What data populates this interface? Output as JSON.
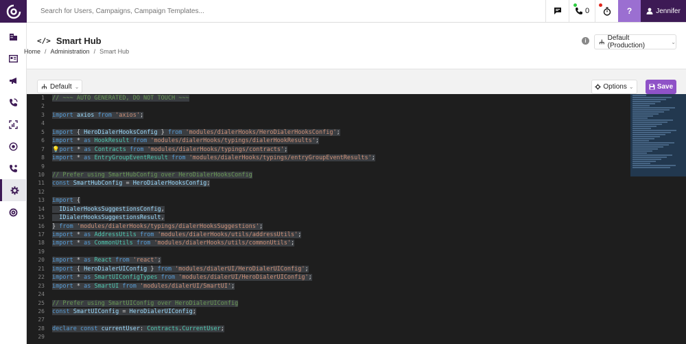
{
  "search": {
    "placeholder": "Search for Users, Campaigns, Campaign Templates..."
  },
  "topbar": {
    "calls_count": "0",
    "user_name": "Jennifer",
    "help_label": "?"
  },
  "header": {
    "title": "Smart Hub",
    "breadcrumb": [
      "Home",
      "Administration",
      "Smart Hub"
    ],
    "environment": "Default (Production)"
  },
  "toolbar": {
    "branch": "Default",
    "options_label": "Options",
    "save_label": "Save"
  },
  "colors": {
    "brand": "#3d1a55",
    "accent": "#8f52c7",
    "help": "#9b6fd1",
    "dot_green": "#2ecc40",
    "dot_red": "#e0261b"
  },
  "sidebar": {
    "items": [
      "building-icon",
      "id-card-icon",
      "megaphone-icon",
      "phone-icon",
      "dashboard-icon",
      "target-icon",
      "phone-settings-icon",
      "gear-icon",
      "logo-mark-icon"
    ],
    "active_index": 7
  },
  "editor": {
    "lines": [
      {
        "n": "1",
        "parts": [
          [
            "cm",
            "// ~~~ AUTO GENERATED, DO NOT TOUCH ~~~"
          ]
        ]
      },
      {
        "n": "2",
        "parts": []
      },
      {
        "n": "3",
        "parts": [
          [
            "kw",
            "import "
          ],
          [
            "id",
            "axios "
          ],
          [
            "kw",
            "from "
          ],
          [
            "str",
            "'axios'"
          ],
          [
            "op",
            ";"
          ]
        ]
      },
      {
        "n": "4",
        "parts": []
      },
      {
        "n": "5",
        "parts": [
          [
            "kw",
            "import "
          ],
          [
            "op",
            "{ "
          ],
          [
            "id",
            "HeroDialerHooksConfig "
          ],
          [
            "op",
            "} "
          ],
          [
            "kw",
            "from "
          ],
          [
            "str",
            "'modules/dialerHooks/HeroDialerHooksConfig'"
          ],
          [
            "op",
            ";"
          ]
        ]
      },
      {
        "n": "6",
        "parts": [
          [
            "kw",
            "import "
          ],
          [
            "op",
            "* "
          ],
          [
            "kw",
            "as "
          ],
          [
            "ty",
            "HookResult "
          ],
          [
            "kw",
            "from "
          ],
          [
            "str",
            "'modules/dialerHooks/typings/dialerHookResults'"
          ],
          [
            "op",
            ";"
          ]
        ]
      },
      {
        "n": "7",
        "parts": [
          [
            "fn",
            "💡"
          ],
          [
            "kw",
            "port "
          ],
          [
            "op",
            "* "
          ],
          [
            "kw",
            "as "
          ],
          [
            "ty",
            "Contracts "
          ],
          [
            "kw",
            "from "
          ],
          [
            "str",
            "'modules/dialerHooks/typings/contracts'"
          ],
          [
            "op",
            ";"
          ]
        ]
      },
      {
        "n": "8",
        "parts": [
          [
            "kw",
            "import "
          ],
          [
            "op",
            "* "
          ],
          [
            "kw",
            "as "
          ],
          [
            "ty",
            "EntryGroupEventResult "
          ],
          [
            "kw",
            "from "
          ],
          [
            "str",
            "'modules/dialerHooks/typings/entryGroupEventResults'"
          ],
          [
            "op",
            ";"
          ]
        ]
      },
      {
        "n": "9",
        "parts": []
      },
      {
        "n": "10",
        "parts": [
          [
            "cm",
            "// Prefer using SmartHubConfig over HeroDialerHooksConfig"
          ]
        ]
      },
      {
        "n": "11",
        "parts": [
          [
            "kw",
            "const "
          ],
          [
            "id",
            "SmartHubConfig "
          ],
          [
            "op",
            "= "
          ],
          [
            "id",
            "HeroDialerHooksConfig"
          ],
          [
            "op",
            ";"
          ]
        ]
      },
      {
        "n": "12",
        "parts": []
      },
      {
        "n": "13",
        "parts": [
          [
            "kw",
            "import "
          ],
          [
            "op",
            "{"
          ]
        ]
      },
      {
        "n": "14",
        "parts": [
          [
            "id",
            "  IDialerHooksSuggestionsConfig"
          ],
          [
            "op",
            ","
          ]
        ]
      },
      {
        "n": "15",
        "parts": [
          [
            "id",
            "  IDialerHooksSuggestionsResult"
          ],
          [
            "op",
            ","
          ]
        ]
      },
      {
        "n": "16",
        "parts": [
          [
            "op",
            "} "
          ],
          [
            "kw",
            "from "
          ],
          [
            "str",
            "'modules/dialerHooks/typings/dialerHooksSuggestions'"
          ],
          [
            "op",
            ";"
          ]
        ]
      },
      {
        "n": "17",
        "parts": [
          [
            "kw",
            "import "
          ],
          [
            "op",
            "* "
          ],
          [
            "kw",
            "as "
          ],
          [
            "ty",
            "AddressUtils "
          ],
          [
            "kw",
            "from "
          ],
          [
            "str",
            "'modules/dialerHooks/utils/addressUtils'"
          ],
          [
            "op",
            ";"
          ]
        ]
      },
      {
        "n": "18",
        "parts": [
          [
            "kw",
            "import "
          ],
          [
            "op",
            "* "
          ],
          [
            "kw",
            "as "
          ],
          [
            "ty",
            "CommonUtils "
          ],
          [
            "kw",
            "from "
          ],
          [
            "str",
            "'modules/dialerHooks/utils/commonUtils'"
          ],
          [
            "op",
            ";"
          ]
        ]
      },
      {
        "n": "19",
        "parts": []
      },
      {
        "n": "20",
        "parts": [
          [
            "kw",
            "import "
          ],
          [
            "op",
            "* "
          ],
          [
            "kw",
            "as "
          ],
          [
            "ty",
            "React "
          ],
          [
            "kw",
            "from "
          ],
          [
            "str",
            "'react'"
          ],
          [
            "op",
            ";"
          ]
        ]
      },
      {
        "n": "21",
        "parts": [
          [
            "kw",
            "import "
          ],
          [
            "op",
            "{ "
          ],
          [
            "id",
            "HeroDialerUIConfig "
          ],
          [
            "op",
            "} "
          ],
          [
            "kw",
            "from "
          ],
          [
            "str",
            "'modules/dialerUI/HeroDialerUIConfig'"
          ],
          [
            "op",
            ";"
          ]
        ]
      },
      {
        "n": "22",
        "parts": [
          [
            "kw",
            "import "
          ],
          [
            "op",
            "* "
          ],
          [
            "kw",
            "as "
          ],
          [
            "ty",
            "SmartUIConfigTypes "
          ],
          [
            "kw",
            "from "
          ],
          [
            "str",
            "'modules/dialerUI/HeroDialerUIConfig'"
          ],
          [
            "op",
            ";"
          ]
        ]
      },
      {
        "n": "23",
        "parts": [
          [
            "kw",
            "import "
          ],
          [
            "op",
            "* "
          ],
          [
            "kw",
            "as "
          ],
          [
            "ty",
            "SmartUI "
          ],
          [
            "kw",
            "from "
          ],
          [
            "str",
            "'modules/dialerUI/SmartUI'"
          ],
          [
            "op",
            ";"
          ]
        ]
      },
      {
        "n": "24",
        "parts": []
      },
      {
        "n": "25",
        "parts": [
          [
            "cm",
            "// Prefer using SmartUIConfig over HeroDialerUIConfig"
          ]
        ]
      },
      {
        "n": "26",
        "parts": [
          [
            "kw",
            "const "
          ],
          [
            "id",
            "SmartUIConfig "
          ],
          [
            "op",
            "= "
          ],
          [
            "id",
            "HeroDialerUIConfig"
          ],
          [
            "op",
            ";"
          ]
        ]
      },
      {
        "n": "27",
        "parts": []
      },
      {
        "n": "28",
        "parts": [
          [
            "kw",
            "declare "
          ],
          [
            "kw",
            "const "
          ],
          [
            "id",
            "currentUser"
          ],
          [
            "op",
            ": "
          ],
          [
            "ty",
            "Contracts"
          ],
          [
            "op",
            "."
          ],
          [
            "ty",
            "CurrentUser"
          ],
          [
            "op",
            ";"
          ]
        ]
      },
      {
        "n": "29",
        "parts": []
      }
    ]
  }
}
